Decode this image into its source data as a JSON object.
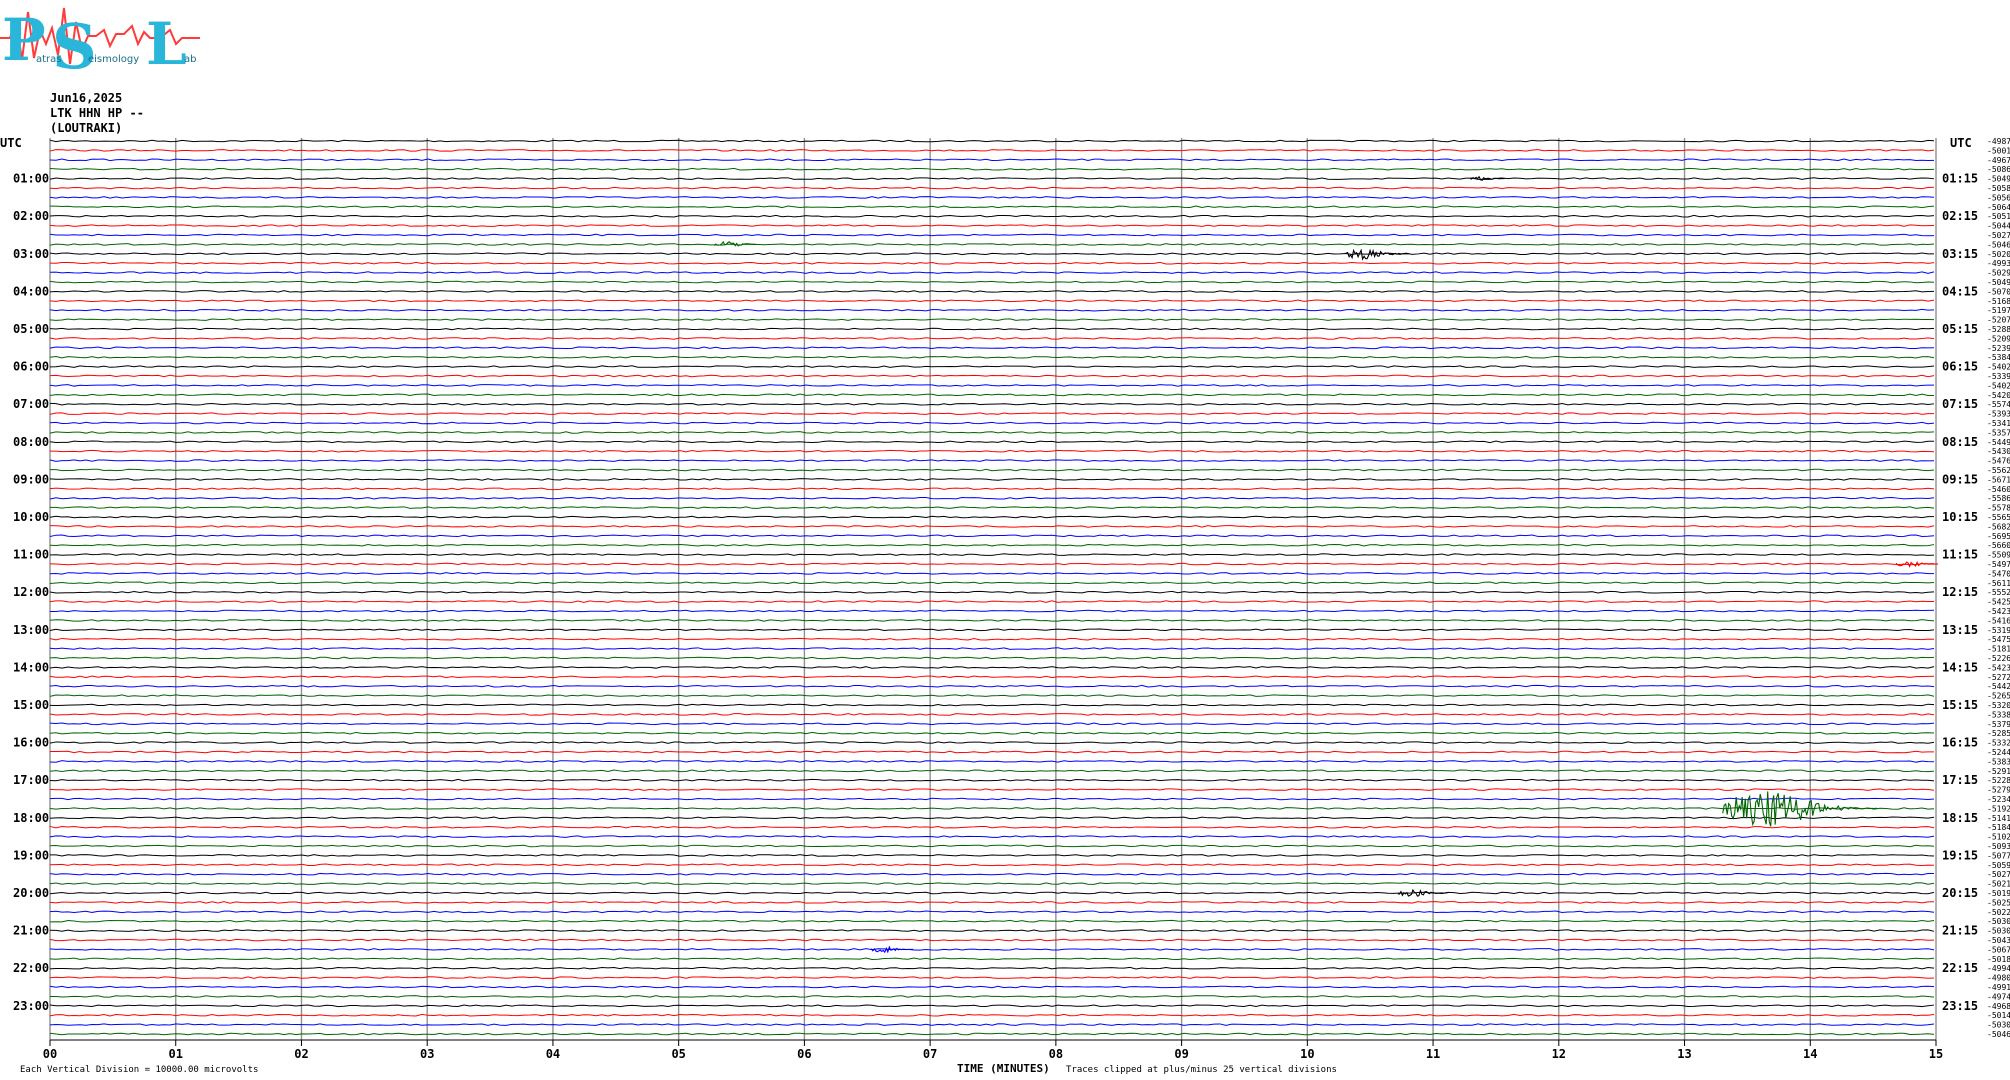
{
  "logo": {
    "letters": [
      "P",
      "S",
      "L"
    ],
    "small_text": [
      "atras",
      "eismology",
      "ab"
    ],
    "colors": {
      "letters": "#29b6d8",
      "trace": "#ff3b3b"
    }
  },
  "header": {
    "date": "Jun16,2025",
    "channel": "LTK HHN HP --",
    "station": "(LOUTRAKI)"
  },
  "axes": {
    "left_title": "UTC",
    "right_title": "UTC",
    "xlabel": "TIME (MINUTES)",
    "x_ticks": [
      "00",
      "01",
      "02",
      "03",
      "04",
      "05",
      "06",
      "07",
      "08",
      "09",
      "10",
      "11",
      "12",
      "13",
      "14",
      "15"
    ]
  },
  "footer": {
    "scale_note": "Each Vertical Division = 10000.00 microvolts",
    "clip_note": "Traces clipped at plus/minus 25 vertical divisions"
  },
  "chart_data": {
    "type": "line",
    "title": "Jun16,2025 LTK HHN HP -- (LOUTRAKI)",
    "xlabel": "TIME (MINUTES)",
    "ylabel": "UTC",
    "xlim": [
      0,
      15
    ],
    "trace_minutes": 15,
    "trace_colors": [
      "#000000",
      "#ff0000",
      "#0000ff",
      "#006400"
    ],
    "left_labels": [
      "01:00",
      "02:00",
      "03:00",
      "04:00",
      "05:00",
      "06:00",
      "07:00",
      "08:00",
      "09:00",
      "10:00",
      "11:00",
      "12:00",
      "13:00",
      "14:00",
      "15:00",
      "16:00",
      "17:00",
      "18:00",
      "19:00",
      "20:00",
      "21:00",
      "22:00",
      "23:00"
    ],
    "right_labels": [
      "01:15",
      "02:15",
      "03:15",
      "04:15",
      "05:15",
      "06:15",
      "07:15",
      "08:15",
      "09:15",
      "10:15",
      "11:15",
      "12:15",
      "13:15",
      "14:15",
      "15:15",
      "16:15",
      "17:15",
      "18:15",
      "19:15",
      "20:15",
      "21:15",
      "22:15",
      "23:15"
    ],
    "offsets": [
      "-4987",
      "-5001",
      "-4967",
      "-5086",
      "-5049",
      "-5058",
      "-5056",
      "-5064",
      "-5051",
      "-5044",
      "-5027",
      "-5046",
      "-5020",
      "-4993",
      "-5029",
      "-5049",
      "-5070",
      "-5168",
      "-5197",
      "-5207",
      "-5288",
      "-5209",
      "-5239",
      "-5384",
      "-5402",
      "-5339",
      "-5402",
      "-5420",
      "-5574",
      "-5393",
      "-5341",
      "-5357",
      "-5449",
      "-5430",
      "-5476",
      "-5562",
      "-5671",
      "-5460",
      "-5586",
      "-5578",
      "-5565",
      "-5682",
      "-5695",
      "-5660",
      "-5509",
      "-5497",
      "-5470",
      "-5611",
      "-5552",
      "-5425",
      "-5423",
      "-5416",
      "-5319",
      "-5475",
      "-5181",
      "-5226",
      "-5423",
      "-5272",
      "-5442",
      "-5265",
      "-5320",
      "-5338",
      "-5379",
      "-5285",
      "-5332",
      "-5244",
      "-5383",
      "-5291",
      "-5228",
      "-5279",
      "-5234",
      "-5192",
      "-5141",
      "-5184",
      "-5102",
      "-5093",
      "-5077",
      "-5059",
      "-5027",
      "-5021",
      "-5019",
      "-5025",
      "-5022",
      "-5030",
      "-5030",
      "-5043",
      "-5067",
      "-5018",
      "-4994",
      "-4980",
      "-4991",
      "-4974",
      "-4968",
      "-5014",
      "-5030",
      "-5046"
    ],
    "events": [
      {
        "trace_time": "02:45",
        "minute": 5.35,
        "amplitude": 3
      },
      {
        "trace_time": "03:00",
        "minute": 10.4,
        "amplitude": 6
      },
      {
        "trace_time": "01:00",
        "minute": 11.35,
        "amplitude": 2
      },
      {
        "trace_time": "11:15",
        "minute": 14.75,
        "amplitude": 3
      },
      {
        "trace_time": "17:45",
        "minute": 13.55,
        "amplitude": 18
      },
      {
        "trace_time": "20:00",
        "minute": 10.8,
        "amplitude": 4
      },
      {
        "trace_time": "21:30",
        "minute": 6.6,
        "amplitude": 3
      }
    ]
  }
}
